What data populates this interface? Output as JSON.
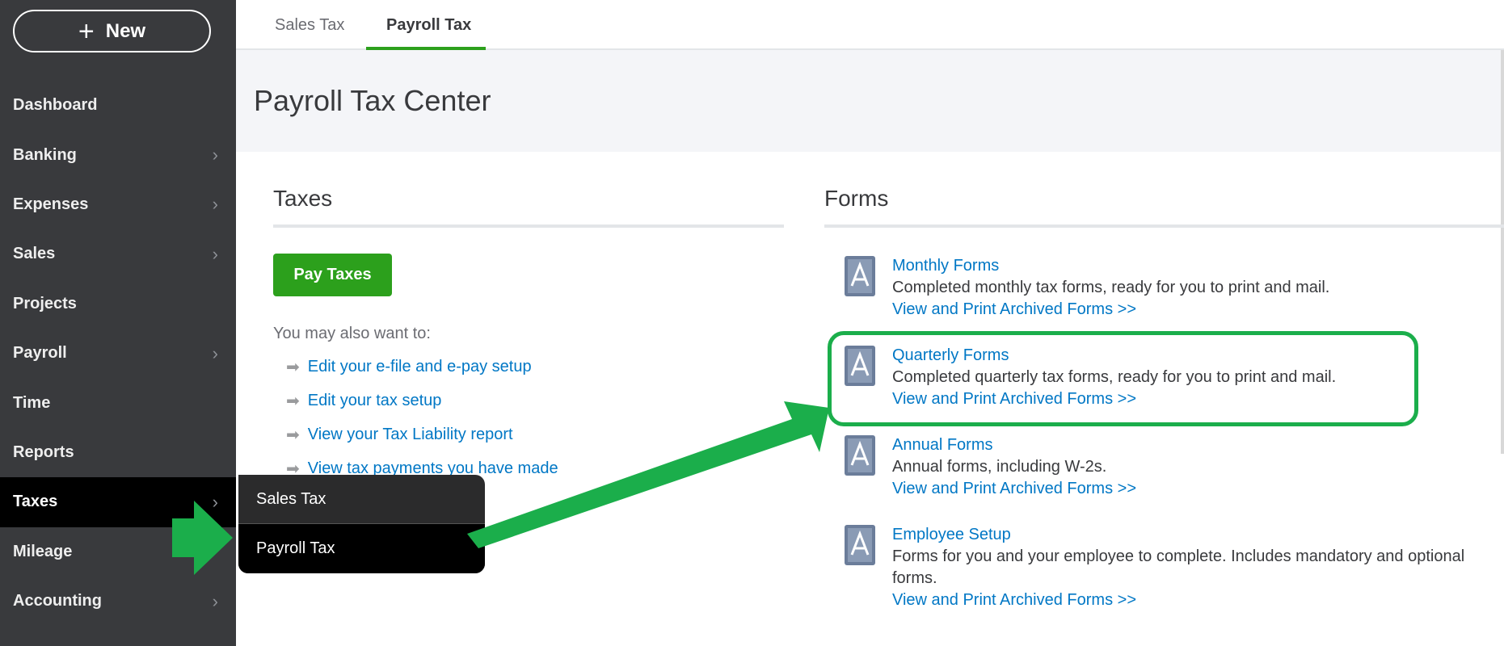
{
  "sidebar": {
    "new_button": "New",
    "items": [
      {
        "label": "Dashboard",
        "chevron": false
      },
      {
        "label": "Banking",
        "chevron": true
      },
      {
        "label": "Expenses",
        "chevron": true
      },
      {
        "label": "Sales",
        "chevron": true
      },
      {
        "label": "Projects",
        "chevron": false
      },
      {
        "label": "Payroll",
        "chevron": true
      },
      {
        "label": "Time",
        "chevron": false
      },
      {
        "label": "Reports",
        "chevron": false
      },
      {
        "label": "Taxes",
        "chevron": true,
        "active": true
      },
      {
        "label": "Mileage",
        "chevron": false
      },
      {
        "label": "Accounting",
        "chevron": true
      }
    ],
    "flyout": [
      "Sales Tax",
      "Payroll Tax"
    ]
  },
  "tabs": [
    "Sales Tax",
    "Payroll Tax"
  ],
  "page_title": "Payroll Tax Center",
  "taxes": {
    "title": "Taxes",
    "pay_button": "Pay Taxes",
    "also_text": "You may also want to:",
    "links": [
      "Edit your e-file and e-pay setup",
      "Edit your tax setup",
      "View your Tax Liability report",
      "View tax payments you have made"
    ]
  },
  "forms": {
    "title": "Forms",
    "items": [
      {
        "title": "Monthly Forms",
        "desc": "Completed monthly tax forms, ready for you to print and mail.",
        "link": "View and Print Archived Forms >>"
      },
      {
        "title": "Quarterly Forms",
        "desc": "Completed quarterly tax forms, ready for you to print and mail.",
        "link": "View and Print Archived Forms >>"
      },
      {
        "title": "Annual Forms",
        "desc": "Annual forms, including W-2s.",
        "link": "View and Print Archived Forms >>"
      },
      {
        "title": "Employee Setup",
        "desc": "Forms for you and your employee to complete. Includes mandatory and optional forms.",
        "link": "View and Print Archived Forms >>"
      }
    ]
  },
  "icons": {
    "plus": "plus-icon",
    "chevron": "chevron-right-icon",
    "link_arrow": "arrow-right-icon",
    "form": "pdf-document-icon"
  },
  "colors": {
    "sidebar_bg": "#393a3d",
    "accent_green": "#2ca01c",
    "link_blue": "#0077c5",
    "annotation_green": "#1bae4b"
  }
}
